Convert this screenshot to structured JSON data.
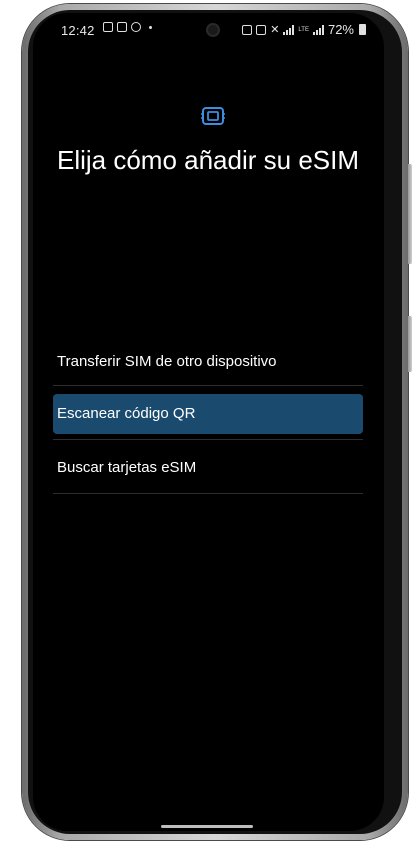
{
  "status_bar": {
    "time": "12:42",
    "battery_text": "72%",
    "network_label": "LTE"
  },
  "header": {
    "icon": "sim-card-icon",
    "title": "Elija cómo añadir su eSIM"
  },
  "options": [
    {
      "label": "Transferir SIM de otro dispositivo"
    },
    {
      "label": "Escanear código QR",
      "selected": true
    },
    {
      "label": "Buscar tarjetas eSIM"
    }
  ],
  "colors": {
    "background": "#000000",
    "selected_highlight": "#1a4a6e",
    "accent_icon": "#3a8fe0",
    "text": "#ffffff"
  }
}
